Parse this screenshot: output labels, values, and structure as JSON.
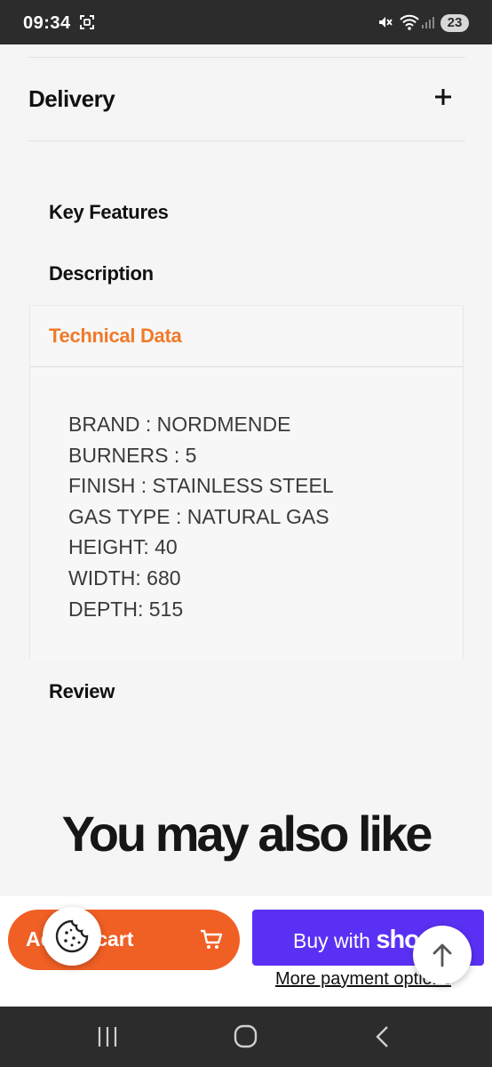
{
  "status_bar": {
    "time": "09:34",
    "battery": "23"
  },
  "accordion": {
    "delivery_label": "Delivery"
  },
  "tabs": {
    "key_features": "Key Features",
    "description": "Description",
    "technical_data": "Technical Data",
    "review": "Review"
  },
  "technical_data": {
    "specs": [
      "BRAND : NORDMENDE",
      "BURNERS : 5",
      "FINISH : STAINLESS STEEL",
      "GAS TYPE : NATURAL GAS",
      "HEIGHT: 40",
      "WIDTH: 680",
      "DEPTH: 515"
    ]
  },
  "recommendations": {
    "heading": "You may also like"
  },
  "sticky_bar": {
    "add_to_cart_label": "Add to cart",
    "buy_prefix": "Buy with",
    "buy_brand": "shop",
    "more_payment_options": "More payment options"
  },
  "colors": {
    "accent_orange": "#f05f24",
    "active_tab": "#f07a2a",
    "shop_purple": "#5a31f4"
  },
  "icons": [
    "screen-record-icon",
    "mute-icon",
    "wifi-icon",
    "signal-icon",
    "plus-icon",
    "cart-icon",
    "cookie-icon",
    "arrow-up-icon",
    "recents-icon",
    "home-icon",
    "back-icon"
  ]
}
